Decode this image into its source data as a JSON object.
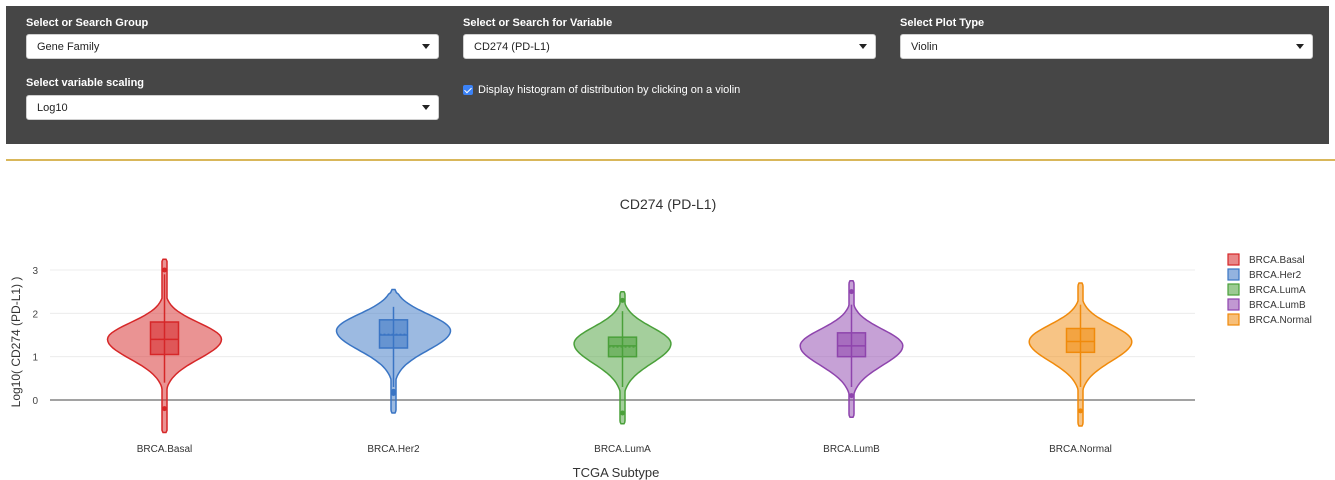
{
  "controls": {
    "group": {
      "label": "Select or Search Group",
      "value": "Gene Family"
    },
    "variable": {
      "label": "Select or Search for Variable",
      "value": "CD274 (PD-L1)"
    },
    "plot_type": {
      "label": "Select Plot Type",
      "value": "Violin"
    },
    "scaling": {
      "label": "Select variable scaling",
      "value": "Log10"
    },
    "histogram_checkbox": {
      "label": "Display histogram of distribution by clicking on a violin",
      "checked": true
    }
  },
  "colors": {
    "panel_bg": "#464646",
    "divider": "#d9b75a"
  },
  "chart_data": {
    "type": "violin",
    "title": "CD274 (PD-L1)",
    "xlabel": "TCGA Subtype",
    "ylabel": "Log10( CD274 (PD-L1) )",
    "ylim": [
      -0.75,
      3.4
    ],
    "yticks": [
      0,
      1,
      2,
      3
    ],
    "legend_position": "right",
    "categories": [
      "BRCA.Basal",
      "BRCA.Her2",
      "BRCA.LumA",
      "BRCA.LumB",
      "BRCA.Normal"
    ],
    "series": [
      {
        "name": "BRCA.Basal",
        "color": "#d62728",
        "min": -0.75,
        "max": 3.25,
        "q1": 1.05,
        "median": 1.4,
        "mean": 1.4,
        "q3": 1.8,
        "whisker_low": 0.4,
        "whisker_high": 2.9,
        "peak": 1.4,
        "width": 1.0,
        "outliers": [
          -0.2,
          3.0
        ]
      },
      {
        "name": "BRCA.Her2",
        "color": "#3a75c4",
        "min": -0.3,
        "max": 2.55,
        "q1": 1.2,
        "median": 1.5,
        "mean": 1.52,
        "q3": 1.85,
        "whisker_low": 0.3,
        "whisker_high": 2.15,
        "peak": 1.6,
        "width": 1.0,
        "outliers": [
          0.15,
          0.2
        ]
      },
      {
        "name": "BRCA.LumA",
        "color": "#4aa03a",
        "min": -0.55,
        "max": 2.5,
        "q1": 1.0,
        "median": 1.25,
        "mean": 1.22,
        "q3": 1.45,
        "whisker_low": 0.3,
        "whisker_high": 2.05,
        "peak": 1.3,
        "width": 0.85,
        "outliers": [
          -0.3,
          2.3
        ]
      },
      {
        "name": "BRCA.LumB",
        "color": "#8e44ad",
        "min": -0.4,
        "max": 2.75,
        "q1": 1.0,
        "median": 1.25,
        "mean": 1.25,
        "q3": 1.55,
        "whisker_low": 0.3,
        "whisker_high": 2.2,
        "peak": 1.25,
        "width": 0.9,
        "outliers": [
          0.1,
          2.5
        ]
      },
      {
        "name": "BRCA.Normal",
        "color": "#f08a0b",
        "min": -0.6,
        "max": 2.7,
        "q1": 1.1,
        "median": 1.35,
        "mean": 1.35,
        "q3": 1.65,
        "whisker_low": 0.3,
        "whisker_high": 2.2,
        "peak": 1.35,
        "width": 0.9,
        "outliers": [
          -0.25
        ]
      }
    ]
  }
}
